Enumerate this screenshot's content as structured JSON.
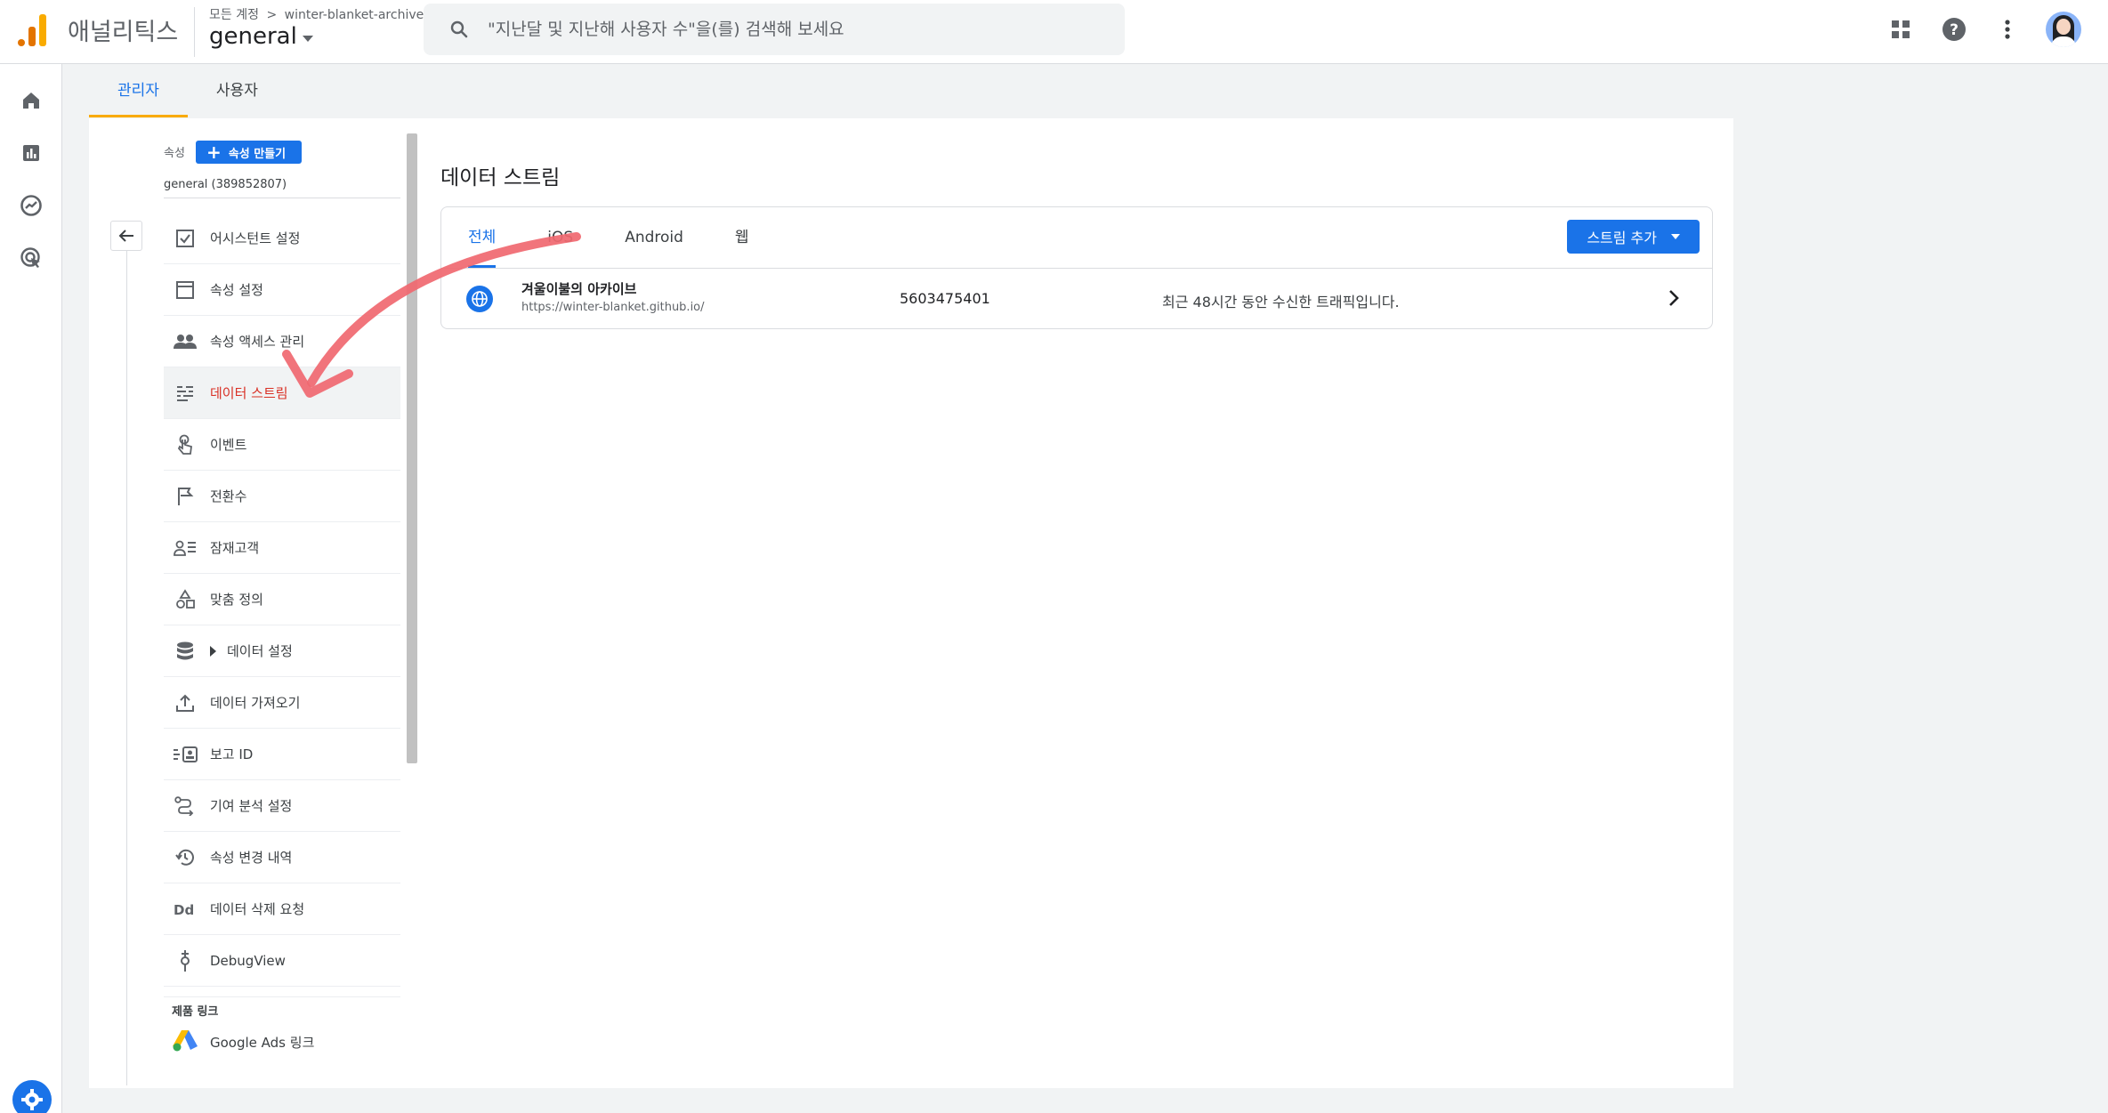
{
  "header": {
    "product_name": "애널리틱스",
    "breadcrumb": {
      "root": "모든 계정",
      "separator": ">",
      "account": "winter-blanket-archive"
    },
    "property_selector": "general",
    "search_placeholder": "\"지난달 및 지난해 사용자 수\"을(를) 검색해 보세요",
    "icons": [
      "apps-grid-icon",
      "help-icon",
      "more-vert-icon",
      "avatar"
    ]
  },
  "rail": {
    "items": [
      "home-icon",
      "reports-icon",
      "explore-icon",
      "advertising-icon"
    ],
    "bottom": "settings-icon"
  },
  "admin_tabs": [
    {
      "label": "관리자",
      "active": true
    },
    {
      "label": "사용자",
      "active": false
    }
  ],
  "property_panel": {
    "label": "속성",
    "create_button": "속성 만들기",
    "property_name": "general (389852807)"
  },
  "menu": [
    {
      "label": "어시스턴트 설정",
      "icon": "checkbox-icon"
    },
    {
      "label": "속성 설정",
      "icon": "layout-icon"
    },
    {
      "label": "속성 액세스 관리",
      "icon": "people-icon"
    },
    {
      "label": "데이터 스트림",
      "icon": "streams-icon",
      "active": true
    },
    {
      "label": "이벤트",
      "icon": "touch-icon"
    },
    {
      "label": "전환수",
      "icon": "flag-icon"
    },
    {
      "label": "잠재고객",
      "icon": "audience-icon"
    },
    {
      "label": "맞춤 정의",
      "icon": "shapes-icon"
    },
    {
      "label": "데이터 설정",
      "icon": "database-icon",
      "expandable": true
    },
    {
      "label": "데이터 가져오기",
      "icon": "upload-icon"
    },
    {
      "label": "보고 ID",
      "icon": "id-card-icon"
    },
    {
      "label": "기여 분석 설정",
      "icon": "route-icon"
    },
    {
      "label": "속성 변경 내역",
      "icon": "history-icon"
    },
    {
      "label": "데이터 삭제 요청",
      "icon": "dd-icon"
    },
    {
      "label": "DebugView",
      "icon": "debug-icon"
    }
  ],
  "product_links": {
    "label": "제품 링크",
    "items": [
      {
        "label": "Google Ads 링크",
        "icon": "google-ads-icon"
      }
    ]
  },
  "content": {
    "title": "데이터 스트림",
    "tabs": [
      {
        "label": "전체",
        "active": true
      },
      {
        "label": "iOS",
        "active": false
      },
      {
        "label": "Android",
        "active": false
      },
      {
        "label": "웹",
        "active": false
      }
    ],
    "add_stream_button": "스트림 추가",
    "streams": [
      {
        "name": "겨울이불의 아카이브",
        "url": "https://winter-blanket.github.io/",
        "id": "5603475401",
        "status": "최근 48시간 동안 수신한 트래픽입니다."
      }
    ]
  },
  "colors": {
    "primary": "#1a73e8",
    "active_menu_text": "#d93025",
    "annotation_arrow": "#f06870",
    "tab_indicator": "#f9ab00"
  }
}
